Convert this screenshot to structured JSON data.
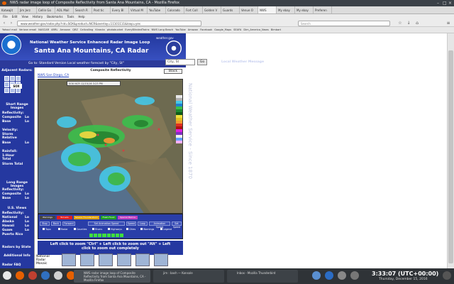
{
  "window": {
    "title": "NWS radar image loop of Composite Reflectivity from Santa Ana Mountains, CA - Mozilla Firefox"
  },
  "tabs": [
    "Katwajit",
    "Jim Jerz",
    "Cellin Go",
    "AOL Mail",
    "Search R",
    "Post tic",
    "Every Bl",
    "Virtual M",
    "YouTube",
    "Colorado",
    "Fort Coll",
    "Golden V",
    "Guards",
    "Venue O",
    "NWS",
    "My ebay",
    "My ebay",
    "Preferen"
  ],
  "menu": [
    "File",
    "Edit",
    "View",
    "History",
    "Bookmarks",
    "Tools",
    "Help"
  ],
  "url": "www.weather.gov/radar.php?rid=SOX&product=NCR&overlay=11101111&loop=yes",
  "search_placeholder": "Search",
  "bookmarks": [
    "Yahoo! mail",
    "Verizon email",
    "NASCAR",
    "ARRL",
    "Amazon",
    "QRZ",
    "Cellcalling",
    "Kinecta",
    "photobucket",
    "EveryBlindedTrains",
    "NWS Long Beach",
    "YouTube",
    "Amazon",
    "Facebook",
    "Google_Maps",
    "SEAFA",
    "Dim_America_News",
    "Bimbart"
  ],
  "header": {
    "line1": "National Weather Service Enhanced Radar Image Loop",
    "line2": "Santa Ana Mountains, CA Radar",
    "weather_gov": "weather.gov",
    "go_text": "Go to: Standard Version       Local weather forecast by \"City, St\"",
    "city_value": "City, St",
    "go_button": "Go",
    "local_msg": "Local Weather Message"
  },
  "sidebar": {
    "adjacent": "Adjacent Radars:",
    "sox": "SOX",
    "short_range": "Short Range Images",
    "reflectivity": "Reflectivity:",
    "composite": "Composite",
    "base": "Base",
    "loop": "Lo",
    "velocity": "Velocity:",
    "storm_relative": "Storm Relative",
    "base2": "Base",
    "rainfall": "Rainfall:",
    "one_hour": "1-Hour Total",
    "storm_total": "Storm Total",
    "long_range": "Long Range Images",
    "reflectivity2": "Reflectivity:",
    "composite2": "Composite",
    "base3": "Base",
    "us_views": "U.S. Views",
    "reflectivity3": "Reflectivity:",
    "national": "National",
    "alaska": "Alaska",
    "hawaii": "Hawaii",
    "guam": "Guam",
    "puerto_rico": "Puerto Rico",
    "radars_by_state": "Radars by State",
    "additional": "Additional Info",
    "radar_faq": "Radar FAQ"
  },
  "main": {
    "title": "Composite Reflectivity",
    "black_button": "Black",
    "nws_link": "NWS San Diego, CA",
    "timestamp": "SOX NCR 12/15/16 3:23 PM",
    "warn_labels": [
      "Warnings",
      "Tornado",
      "Severe Thunderstorm",
      "Flash Flood",
      "Special Marine"
    ],
    "ctrl_labels": [
      "Stop",
      "Back",
      "Forward",
      "Set Animation Speed",
      "Speed",
      "Loop",
      "Animation Speed",
      "Set Speed"
    ],
    "checks": [
      "Topo",
      "Radar",
      "Counties",
      "Rivers",
      "Highways",
      "Cities",
      "Warnings",
      "Legend"
    ],
    "zoom1": "Left click to zoom       \"Ctrl\" + Left click to zoom out       \"Alt\" + Left",
    "zoom2": "click to zoom out completely",
    "national_mosaic": "National Radar Mosaic"
  },
  "side_watermark": "National Weather Service - Since 1870",
  "taskbar": {
    "items": [
      "NWS radar image loop of Composite Reflectivity from Santa Ana Mountains, CA - Mozilla Firefox",
      "jim : bash — Konsole",
      "Inbox - Mozilla Thunderbird"
    ],
    "clock": "3:33:07 (UTC+00:00)",
    "date": "Thursday, December 15, 2016"
  },
  "colors": {
    "header_blue": "#22379c",
    "sidebar_blue": "#2538a0",
    "accent_green": "#3ee03e"
  }
}
